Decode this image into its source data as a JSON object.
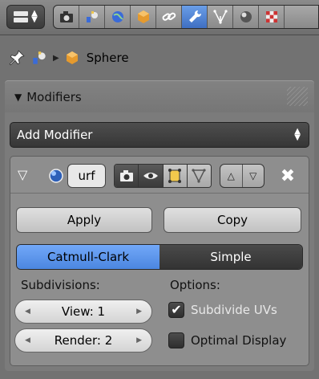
{
  "header": {
    "editor_type_icon": "properties-editor-icon",
    "context_tabs": [
      {
        "name": "render-tab",
        "icon": "camera-icon"
      },
      {
        "name": "scene-tab",
        "icon": "scene-icon"
      },
      {
        "name": "world-tab",
        "icon": "world-icon"
      },
      {
        "name": "object-tab",
        "icon": "cube-icon"
      },
      {
        "name": "constraints-tab",
        "icon": "chain-link-icon"
      },
      {
        "name": "modifiers-tab",
        "icon": "wrench-icon",
        "active": true
      },
      {
        "name": "data-tab",
        "icon": "vertex-data-icon"
      },
      {
        "name": "material-tab",
        "icon": "material-sphere-icon"
      },
      {
        "name": "texture-tab",
        "icon": "checker-texture-icon"
      }
    ]
  },
  "breadcrumb": {
    "object_name": "Sphere"
  },
  "panel": {
    "title": "Modifiers",
    "add_modifier_label": "Add Modifier"
  },
  "modifier": {
    "name": "urf",
    "apply_label": "Apply",
    "copy_label": "Copy",
    "subdivision_types": [
      "Catmull-Clark",
      "Simple"
    ],
    "selected_type": "Catmull-Clark",
    "subdivisions_label": "Subdivisions:",
    "options_label": "Options:",
    "view_label": "View: 1",
    "render_label": "Render: 2",
    "subdivide_uvs_label": "Subdivide UVs",
    "subdivide_uvs_checked": true,
    "optimal_display_label": "Optimal Display",
    "optimal_display_checked": false
  },
  "colors": {
    "accent_active": "#4b86e0",
    "background": "#727272"
  }
}
